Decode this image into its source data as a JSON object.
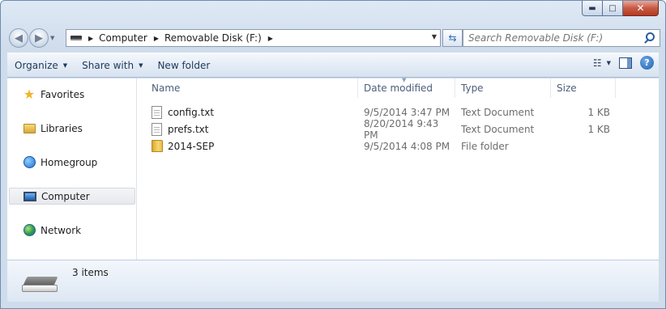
{
  "window": {
    "caption": {
      "minimize": "▬",
      "maximize": "□",
      "close": "✕"
    }
  },
  "navigation": {
    "back_icon": "back-arrow-icon",
    "forward_icon": "forward-arrow-icon",
    "breadcrumbs": [
      "Computer",
      "Removable Disk (F:)"
    ],
    "search_placeholder": "Search Removable Disk (F:)"
  },
  "toolbar": {
    "organize": "Organize",
    "share_with": "Share with",
    "new_folder": "New folder"
  },
  "nav_pane": {
    "items": [
      {
        "label": "Favorites",
        "icon": "star-icon"
      },
      {
        "label": "Libraries",
        "icon": "libraries-icon"
      },
      {
        "label": "Homegroup",
        "icon": "homegroup-icon"
      },
      {
        "label": "Computer",
        "icon": "computer-icon",
        "selected": true
      },
      {
        "label": "Network",
        "icon": "network-icon"
      }
    ]
  },
  "file_list": {
    "columns": [
      "Name",
      "Date modified",
      "Type",
      "Size"
    ],
    "rows": [
      {
        "name": "config.txt",
        "date": "9/5/2014 3:47 PM",
        "type": "Text Document",
        "size": "1 KB",
        "icon": "text-file-icon"
      },
      {
        "name": "prefs.txt",
        "date": "8/20/2014 9:43 PM",
        "type": "Text Document",
        "size": "1 KB",
        "icon": "text-file-icon"
      },
      {
        "name": "2014-SEP",
        "date": "9/5/2014 4:08 PM",
        "type": "File folder",
        "size": "",
        "icon": "folder-icon"
      }
    ]
  },
  "details_pane": {
    "item_count": "3 items",
    "icon": "removable-drive-icon"
  }
}
